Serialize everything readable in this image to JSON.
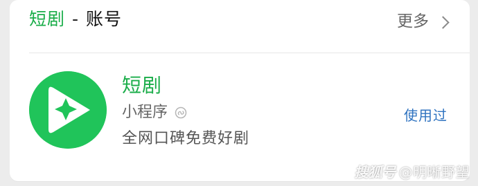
{
  "header": {
    "title_highlight": "短剧",
    "title_separator": "-",
    "title_suffix": "账号",
    "more_label": "更多"
  },
  "result": {
    "name": "短剧",
    "type": "小程序",
    "description": "全网口碑免费好剧",
    "used_label": "使用过"
  },
  "watermark": {
    "brand": "搜狐号",
    "user": "@明晰野望"
  },
  "icons": {
    "more_arrow": "chevron-right-icon",
    "app_logo": "play-sparkle-logo-icon",
    "mini_program": "mini-program-icon"
  },
  "colors": {
    "accent": "#1aad49",
    "link": "#2f73c0",
    "logo_bg": "#20c45a"
  }
}
